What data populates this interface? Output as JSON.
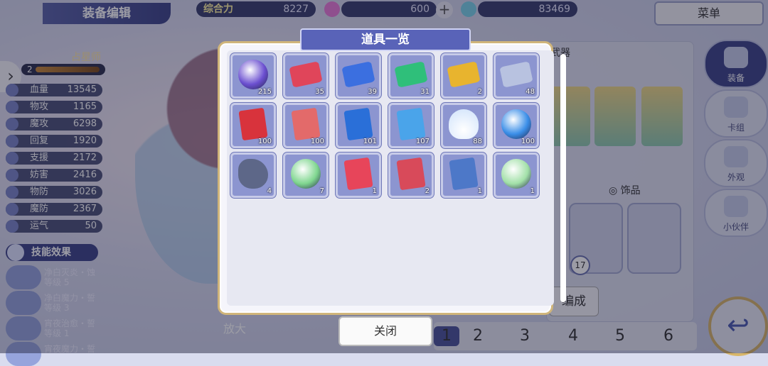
{
  "header": {
    "title": "装备编辑",
    "resources": [
      {
        "label": "综合力",
        "value": "8227"
      },
      {
        "label": "",
        "value": "600"
      },
      {
        "label": "",
        "value": "83469"
      }
    ],
    "plus_label": "+",
    "menu_label": "菜单"
  },
  "character": {
    "class_name": "占星师",
    "level": "2",
    "stats": [
      {
        "name": "血量",
        "value": "13545"
      },
      {
        "name": "物攻",
        "value": "1165"
      },
      {
        "name": "魔攻",
        "value": "6298"
      },
      {
        "name": "回复",
        "value": "1920"
      },
      {
        "name": "支援",
        "value": "2172"
      },
      {
        "name": "妨害",
        "value": "2416"
      },
      {
        "name": "物防",
        "value": "3026"
      },
      {
        "name": "魔防",
        "value": "2367"
      },
      {
        "name": "运气",
        "value": "50"
      }
    ],
    "skills_label": "技能效果",
    "skills": [
      {
        "name": "净白灭炎・蚀",
        "level": "等级 5"
      },
      {
        "name": "净白魔力・誓",
        "level": "等级 3"
      },
      {
        "name": "宵夜治愈・誓",
        "level": "等级 1"
      },
      {
        "name": "宵夜魔力・誓",
        "level": ""
      }
    ]
  },
  "sidebar": {
    "items": [
      {
        "label": "装备"
      },
      {
        "label": "卡组"
      },
      {
        "label": "外观"
      },
      {
        "label": "小伙伴"
      }
    ],
    "back_icon": "↩"
  },
  "equip_panel": {
    "weapon_label": "武器",
    "accessory_label": "饰品",
    "accessory_count": "17",
    "synth_label": "编成"
  },
  "bottom": {
    "zoom_label": "放大",
    "pages": [
      "1",
      "2",
      "3",
      "4",
      "5",
      "6"
    ]
  },
  "dialog": {
    "title": "道具一览",
    "close_label": "关闭",
    "items": [
      {
        "icon": "purple-orb-icon",
        "color": "#6b4fd0",
        "qty": "215"
      },
      {
        "icon": "red-ticket-icon",
        "color": "#e0455a",
        "qty": "35"
      },
      {
        "icon": "blue-ticket-icon",
        "color": "#3b6fe0",
        "qty": "39"
      },
      {
        "icon": "green-ticket-icon",
        "color": "#2fbf7a",
        "qty": "31"
      },
      {
        "icon": "gold-ticket-icon",
        "color": "#e8b42e",
        "qty": "2"
      },
      {
        "icon": "silver-ticket-icon",
        "color": "#b8c2e0",
        "qty": "48"
      },
      {
        "icon": "red-devil-card-icon",
        "color": "#d8333c",
        "qty": "100"
      },
      {
        "icon": "red-devil-card-icon",
        "color": "#e36a6a",
        "qty": "100"
      },
      {
        "icon": "blue-devil-card-icon",
        "color": "#2a6fd8",
        "qty": "101"
      },
      {
        "icon": "blue-devil-card-icon",
        "color": "#4aa4ea",
        "qty": "107"
      },
      {
        "icon": "shell-icon",
        "color": "#cfe2fb",
        "qty": "88"
      },
      {
        "icon": "blue-crystal-orb-icon",
        "color": "#3a8ee8",
        "qty": "100"
      },
      {
        "icon": "stone-icon",
        "color": "#5d6788",
        "qty": "4"
      },
      {
        "icon": "green-feather-token-icon",
        "color": "#7fd68f",
        "qty": "7"
      },
      {
        "icon": "dress-card-icon",
        "color": "#e7455a",
        "qty": "1"
      },
      {
        "icon": "hat-card-icon",
        "color": "#d84a5a",
        "qty": "2"
      },
      {
        "icon": "staff-card-icon",
        "color": "#4d78c8",
        "qty": "1"
      },
      {
        "icon": "green-feather-token-icon",
        "color": "#a2e0a8",
        "qty": "1"
      }
    ]
  }
}
